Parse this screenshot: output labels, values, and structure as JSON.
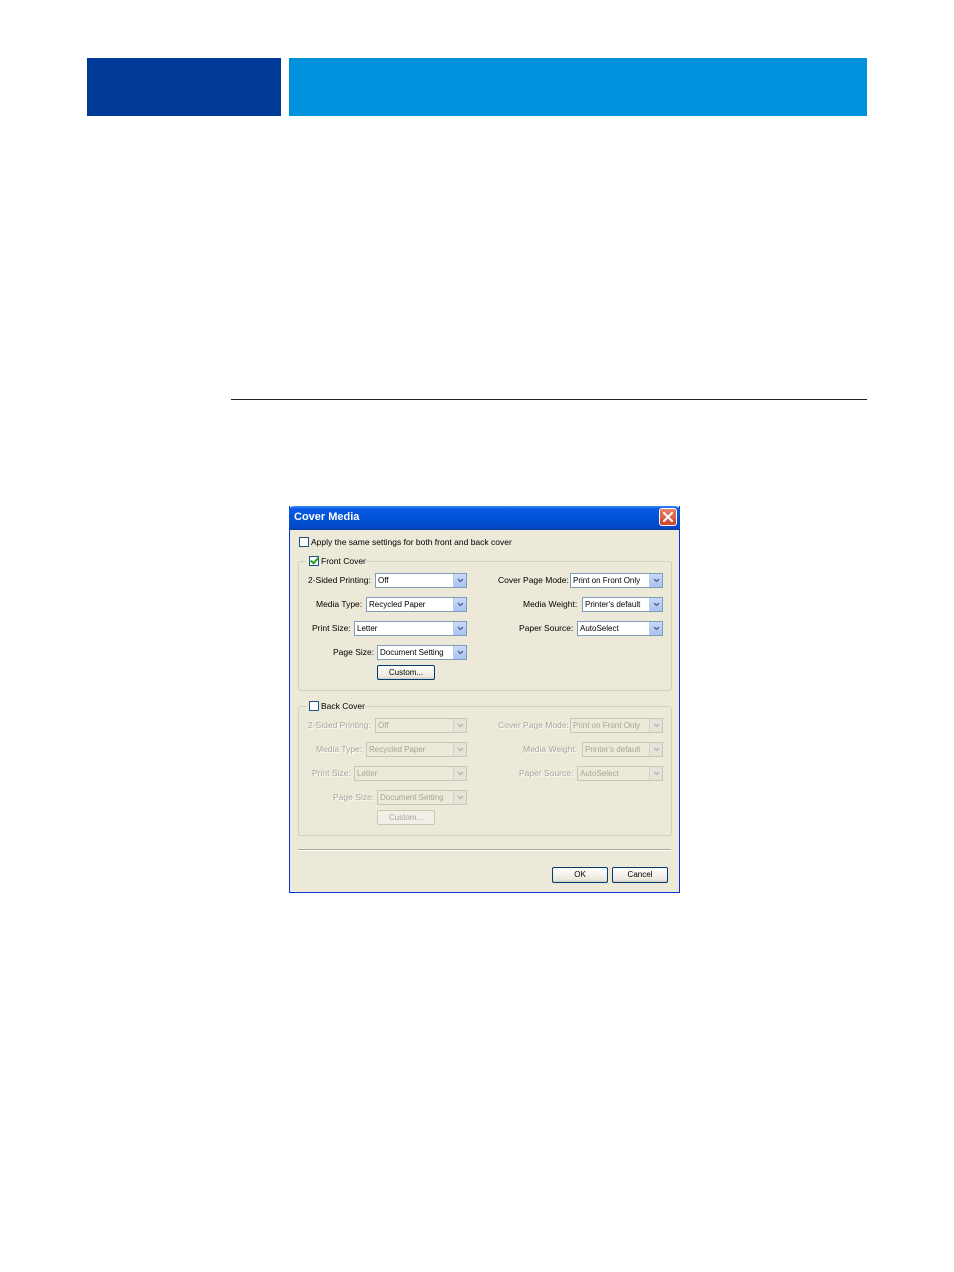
{
  "dialog": {
    "title": "Cover Media",
    "apply_same_label": "Apply the same settings for both front and back cover",
    "apply_same_checked": false,
    "ok_label": "OK",
    "cancel_label": "Cancel"
  },
  "front": {
    "label": "Front Cover",
    "checked": true,
    "two_sided_label": "2-Sided Printing:",
    "two_sided_value": "Off",
    "media_type_label": "Media Type:",
    "media_type_value": "Recycled Paper",
    "print_size_label": "Print Size:",
    "print_size_value": "Letter",
    "page_size_label": "Page Size:",
    "page_size_value": "Document Setting",
    "custom_label": "Custom...",
    "cover_mode_label": "Cover Page Mode:",
    "cover_mode_value": "Print on Front Only",
    "media_weight_label": "Media Weight:",
    "media_weight_value": "Printer's default",
    "paper_source_label": "Paper Source:",
    "paper_source_value": "AutoSelect"
  },
  "back": {
    "label": "Back Cover",
    "checked": false,
    "two_sided_label": "2-Sided Printing:",
    "two_sided_value": "Off",
    "media_type_label": "Media Type:",
    "media_type_value": "Recycled Paper",
    "print_size_label": "Print Size:",
    "print_size_value": "Letter",
    "page_size_label": "Page Size:",
    "page_size_value": "Document Setting",
    "custom_label": "Custom...",
    "cover_mode_label": "Cover Page Mode:",
    "cover_mode_value": "Print on Front Only",
    "media_weight_label": "Media Weight:",
    "media_weight_value": "Printer's default",
    "paper_source_label": "Paper Source:",
    "paper_source_value": "AutoSelect"
  },
  "colors": {
    "header_dark": "#003a98",
    "header_light": "#0091dd",
    "dialog_face": "#ece9d8",
    "titlebar": "#0052d6"
  },
  "icons": {
    "close": "close-icon",
    "dropdown": "chevron-down-icon",
    "check": "check-icon"
  }
}
